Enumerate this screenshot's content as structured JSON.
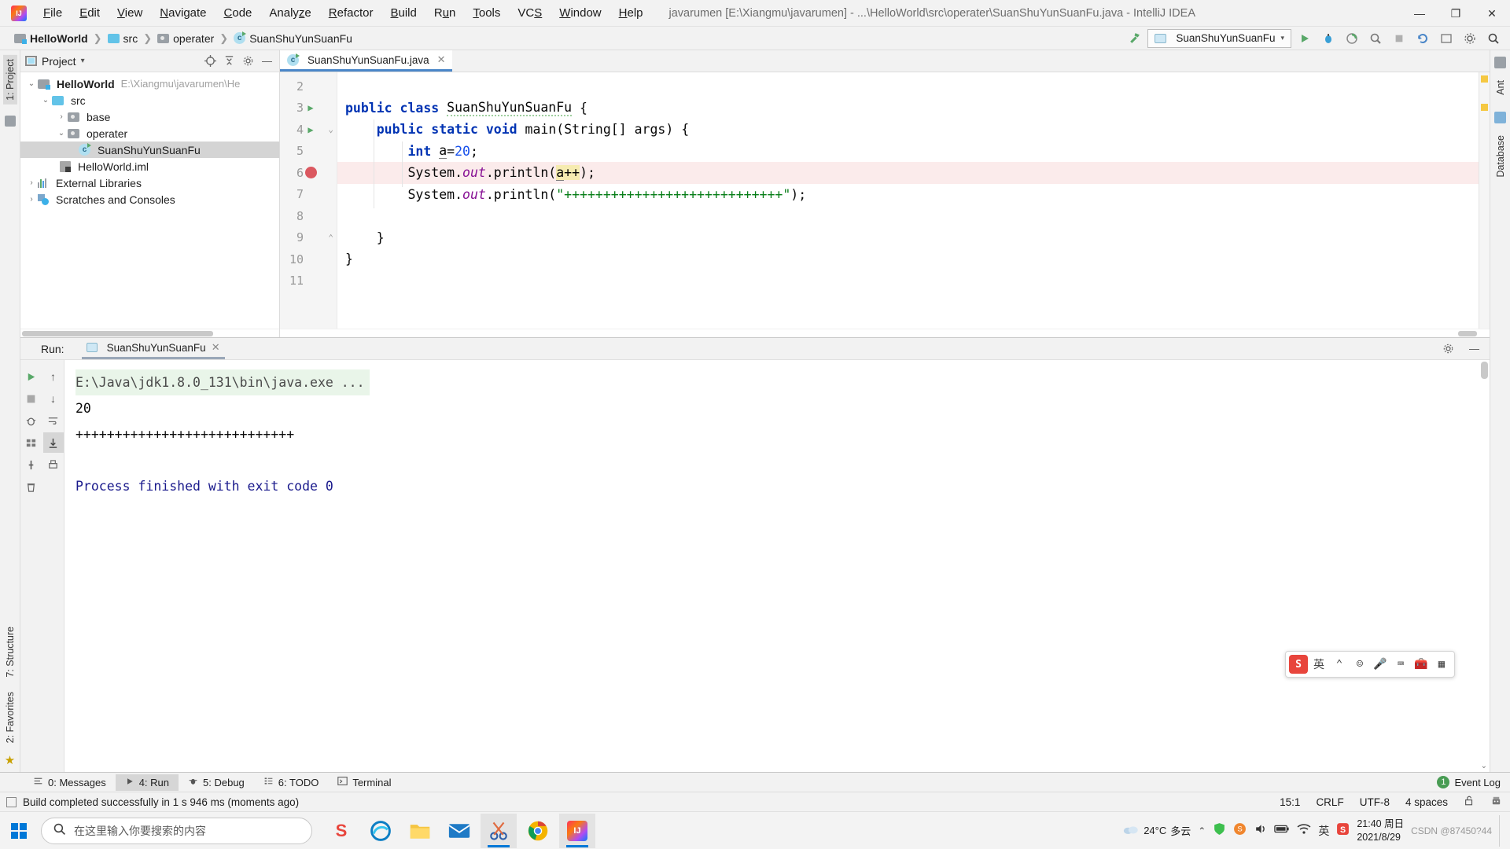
{
  "titlebar": {
    "app_logo": "intellij-logo",
    "menus": [
      "File",
      "Edit",
      "View",
      "Navigate",
      "Code",
      "Analyze",
      "Refactor",
      "Build",
      "Run",
      "Tools",
      "VCS",
      "Window",
      "Help"
    ],
    "window_title": "javarumen [E:\\Xiangmu\\javarumen] - ...\\HelloWorld\\src\\operater\\SuanShuYunSuanFu.java - IntelliJ IDEA",
    "minimize": "—",
    "maximize": "❐",
    "close": "✕"
  },
  "navbar": {
    "breadcrumbs": [
      {
        "label": "HelloWorld",
        "icon": "module-folder-icon"
      },
      {
        "label": "src",
        "icon": "source-folder-icon"
      },
      {
        "label": "operater",
        "icon": "package-folder-icon"
      },
      {
        "label": "SuanShuYunSuanFu",
        "icon": "java-class-icon"
      }
    ],
    "separator": "❯",
    "run_configuration": "SuanShuYunSuanFu",
    "chevron": "▾",
    "build_hammer": "build-icon",
    "run_button": "▶",
    "debug_button": "debug-icon",
    "run_coverage": "coverage-icon",
    "profile": "profile-icon",
    "stop_button": "■",
    "update_button": "update-icon",
    "settings_button": "⚙",
    "search_button": "search-icon"
  },
  "left_strip": {
    "project_tab": "1: Project",
    "structure_tab": "7: Structure",
    "favorites_tab": "2: Favorites"
  },
  "right_strip": {
    "ant_tab": "Ant",
    "database_tab": "Database"
  },
  "project_panel": {
    "title": "Project",
    "title_chevron": "▾",
    "actions": [
      "target-icon",
      "collapse-all-icon",
      "gear-icon",
      "hide-icon"
    ],
    "tree": [
      {
        "label": "HelloWorld",
        "path": "E:\\Xiangmu\\javarumen\\He",
        "icon": "module-folder-icon",
        "arrow": "⌄",
        "indent": 0,
        "bold": true,
        "selected": false
      },
      {
        "label": "src",
        "path": "",
        "icon": "source-folder-icon",
        "arrow": "⌄",
        "indent": 1,
        "bold": false,
        "selected": false
      },
      {
        "label": "base",
        "path": "",
        "icon": "package-folder-icon",
        "arrow": "›",
        "indent": 2,
        "bold": false,
        "selected": false
      },
      {
        "label": "operater",
        "path": "",
        "icon": "package-folder-icon",
        "arrow": "⌄",
        "indent": 2,
        "bold": false,
        "selected": false
      },
      {
        "label": "SuanShuYunSuanFu",
        "path": "",
        "icon": "java-class-icon",
        "arrow": "",
        "indent": 3,
        "bold": false,
        "selected": true
      },
      {
        "label": "HelloWorld.iml",
        "path": "",
        "icon": "iml-file-icon",
        "arrow": "",
        "indent": 2,
        "bold": false,
        "selected": false
      },
      {
        "label": "External Libraries",
        "path": "",
        "icon": "libraries-icon",
        "arrow": "›",
        "indent": 0,
        "bold": false,
        "selected": false
      },
      {
        "label": "Scratches and Consoles",
        "path": "",
        "icon": "scratches-icon",
        "arrow": "›",
        "indent": 0,
        "bold": false,
        "selected": false
      }
    ]
  },
  "editor": {
    "tab": {
      "label": "SuanShuYunSuanFu.java",
      "icon": "java-class-icon",
      "close": "✕"
    },
    "first_visible_line": 2,
    "lines": [
      {
        "num": 2,
        "text": "",
        "runnable": false,
        "breakpoint": false,
        "highlighted": false
      },
      {
        "num": 3,
        "text": "public class SuanShuYunSuanFu {",
        "runnable": true,
        "breakpoint": false,
        "highlighted": false
      },
      {
        "num": 4,
        "text": "    public static void main(String[] args) {",
        "runnable": true,
        "breakpoint": false,
        "highlighted": false,
        "fold": true
      },
      {
        "num": 5,
        "text": "        int a=20;",
        "runnable": false,
        "breakpoint": false,
        "highlighted": false
      },
      {
        "num": 6,
        "text": "        System.out.println(a++);",
        "runnable": false,
        "breakpoint": true,
        "highlighted": true
      },
      {
        "num": 7,
        "text": "        System.out.println(\"++++++++++++++++++++++++++++\");",
        "runnable": false,
        "breakpoint": false,
        "highlighted": false
      },
      {
        "num": 8,
        "text": "",
        "runnable": false,
        "breakpoint": false,
        "highlighted": false
      },
      {
        "num": 9,
        "text": "    }",
        "runnable": false,
        "breakpoint": false,
        "highlighted": false,
        "foldend": true
      },
      {
        "num": 10,
        "text": "}",
        "runnable": false,
        "breakpoint": false,
        "highlighted": false
      },
      {
        "num": 11,
        "text": "",
        "runnable": false,
        "breakpoint": false,
        "highlighted": false
      }
    ],
    "plus_string": "++++++++++++++++++++++++++++"
  },
  "run_panel": {
    "label": "Run:",
    "tab": {
      "label": "SuanShuYunSuanFu",
      "icon": "run-config-icon",
      "close": "✕"
    },
    "settings_icon": "⚙",
    "hide_icon": "—",
    "toolbar": [
      "rerun-icon",
      "scroll-up-icon",
      "stop-icon",
      "scroll-down-icon",
      "debugger-icon",
      "soft-wrap-icon",
      "grid-icon",
      "scroll-to-end-icon",
      "pin-icon",
      "print-icon",
      "trash-icon"
    ],
    "output": [
      {
        "text": "E:\\Java\\jdk1.8.0_131\\bin\\java.exe ...",
        "style": "command"
      },
      {
        "text": "20",
        "style": "normal"
      },
      {
        "text": "++++++++++++++++++++++++++++",
        "style": "normal"
      },
      {
        "text": "",
        "style": "normal"
      },
      {
        "text": "Process finished with exit code 0",
        "style": "finished"
      }
    ]
  },
  "ime_bar": {
    "logo": "S",
    "mode": "英",
    "items": [
      "chevron-icon",
      "emoji-icon",
      "mic-icon",
      "keyboard-icon",
      "toolbox-icon",
      "menu-icon"
    ]
  },
  "tool_window_bar": {
    "items": [
      {
        "label": "0: Messages",
        "icon": "messages-icon",
        "underline": "0",
        "selected": false
      },
      {
        "label": "4: Run",
        "icon": "run-icon",
        "underline": "4",
        "selected": true
      },
      {
        "label": "5: Debug",
        "icon": "debug-icon",
        "underline": "5",
        "selected": false
      },
      {
        "label": "6: TODO",
        "icon": "todo-icon",
        "underline": "6",
        "selected": false
      },
      {
        "label": "Terminal",
        "icon": "terminal-icon",
        "underline": "",
        "selected": false
      }
    ],
    "event_log": {
      "label": "Event Log",
      "count": "1"
    }
  },
  "statusbar": {
    "message": "Build completed successfully in 1 s 946 ms (moments ago)",
    "caret": "15:1",
    "line_separator": "CRLF",
    "encoding": "UTF-8",
    "indent": "4 spaces",
    "lock_icon": "unlocked-icon",
    "inspector_icon": "inspector-icon"
  },
  "taskbar": {
    "start": "windows-start-icon",
    "search_placeholder": "在这里输入你要搜索的内容",
    "search_icon": "search-icon",
    "apps": [
      {
        "name": "sogou-input",
        "glyph": "S",
        "active": false
      },
      {
        "name": "microsoft-edge",
        "glyph": "e",
        "active": false
      },
      {
        "name": "file-explorer",
        "glyph": "📁",
        "active": false
      },
      {
        "name": "mail",
        "glyph": "✉",
        "active": false
      },
      {
        "name": "snipaste",
        "glyph": "✂",
        "active": true
      },
      {
        "name": "google-chrome",
        "glyph": "◎",
        "active": false
      },
      {
        "name": "intellij-idea",
        "glyph": "IJ",
        "active": true
      }
    ],
    "tray": {
      "weather_temp": "24°C",
      "weather_desc": "多云",
      "weather_icon": "cloud-icon",
      "icons": [
        "chevron-up-icon",
        "shield-icon",
        "sogou-icon",
        "volume-icon",
        "battery-icon",
        "wifi-icon",
        "language-icon",
        "sogou-s-icon"
      ],
      "time": "21:40 周日",
      "date": "2021/8/29"
    },
    "watermark": "CSDN @87450?44"
  },
  "colors": {
    "accent_blue": "#4a86c8",
    "keyword": "#0033b3",
    "string": "#067d17",
    "number": "#1750eb",
    "field": "#871094",
    "breakpoint": "#db5860",
    "run_green": "#59a869",
    "highlight_line": "#fbebeb",
    "console_cmd_bg": "#e9f5e9"
  }
}
